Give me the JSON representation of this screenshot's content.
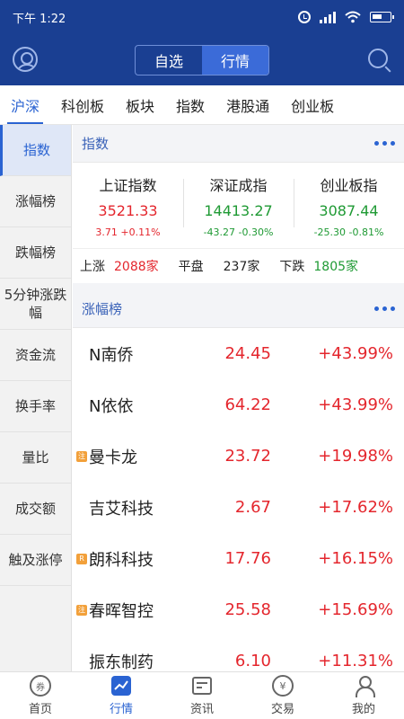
{
  "status": {
    "time": "下午 1:22"
  },
  "header": {
    "tabs": [
      "自选",
      "行情"
    ],
    "active_tab": "行情"
  },
  "market_tabs": [
    "沪深",
    "科创板",
    "板块",
    "指数",
    "港股通",
    "创业板"
  ],
  "sidebar": {
    "items": [
      "指数",
      "涨幅榜",
      "跌幅榜",
      "5分钟涨跌幅",
      "资金流",
      "换手率",
      "量比",
      "成交额",
      "触及涨停"
    ]
  },
  "index_section": {
    "title": "指数",
    "indices": [
      {
        "name": "上证指数",
        "value": "3521.33",
        "change": "3.71 +0.11%",
        "trend": "up"
      },
      {
        "name": "深证成指",
        "value": "14413.27",
        "change": "-43.27 -0.30%",
        "trend": "down"
      },
      {
        "name": "创业板指",
        "value": "3087.44",
        "change": "-25.30 -0.81%",
        "trend": "down"
      }
    ],
    "breadth": {
      "up_label": "上涨",
      "up_count": "2088家",
      "flat_label": "平盘",
      "flat_count": "237家",
      "down_label": "下跌",
      "down_count": "1805家"
    }
  },
  "gain_section": {
    "title": "涨幅榜",
    "rows": [
      {
        "tag": "",
        "name": "N南侨",
        "price": "24.45",
        "pct": "+43.99%"
      },
      {
        "tag": "",
        "name": "N依依",
        "price": "64.22",
        "pct": "+43.99%"
      },
      {
        "tag": "注",
        "name": "曼卡龙",
        "price": "23.72",
        "pct": "+19.98%"
      },
      {
        "tag": "",
        "name": "吉艾科技",
        "price": "2.67",
        "pct": "+17.62%"
      },
      {
        "tag": "R",
        "name": "朗科科技",
        "price": "17.76",
        "pct": "+16.15%"
      },
      {
        "tag": "注",
        "name": "春晖智控",
        "price": "25.58",
        "pct": "+15.69%"
      },
      {
        "tag": "",
        "name": "振东制药",
        "price": "6.10",
        "pct": "+11.31%"
      }
    ]
  },
  "bottom_nav": {
    "items": [
      "首页",
      "行情",
      "资讯",
      "交易",
      "我的"
    ],
    "active": "行情"
  },
  "colors": {
    "brand": "#1a3f92",
    "accent": "#2a63d2",
    "up": "#e4262d",
    "down": "#1f9a34"
  }
}
